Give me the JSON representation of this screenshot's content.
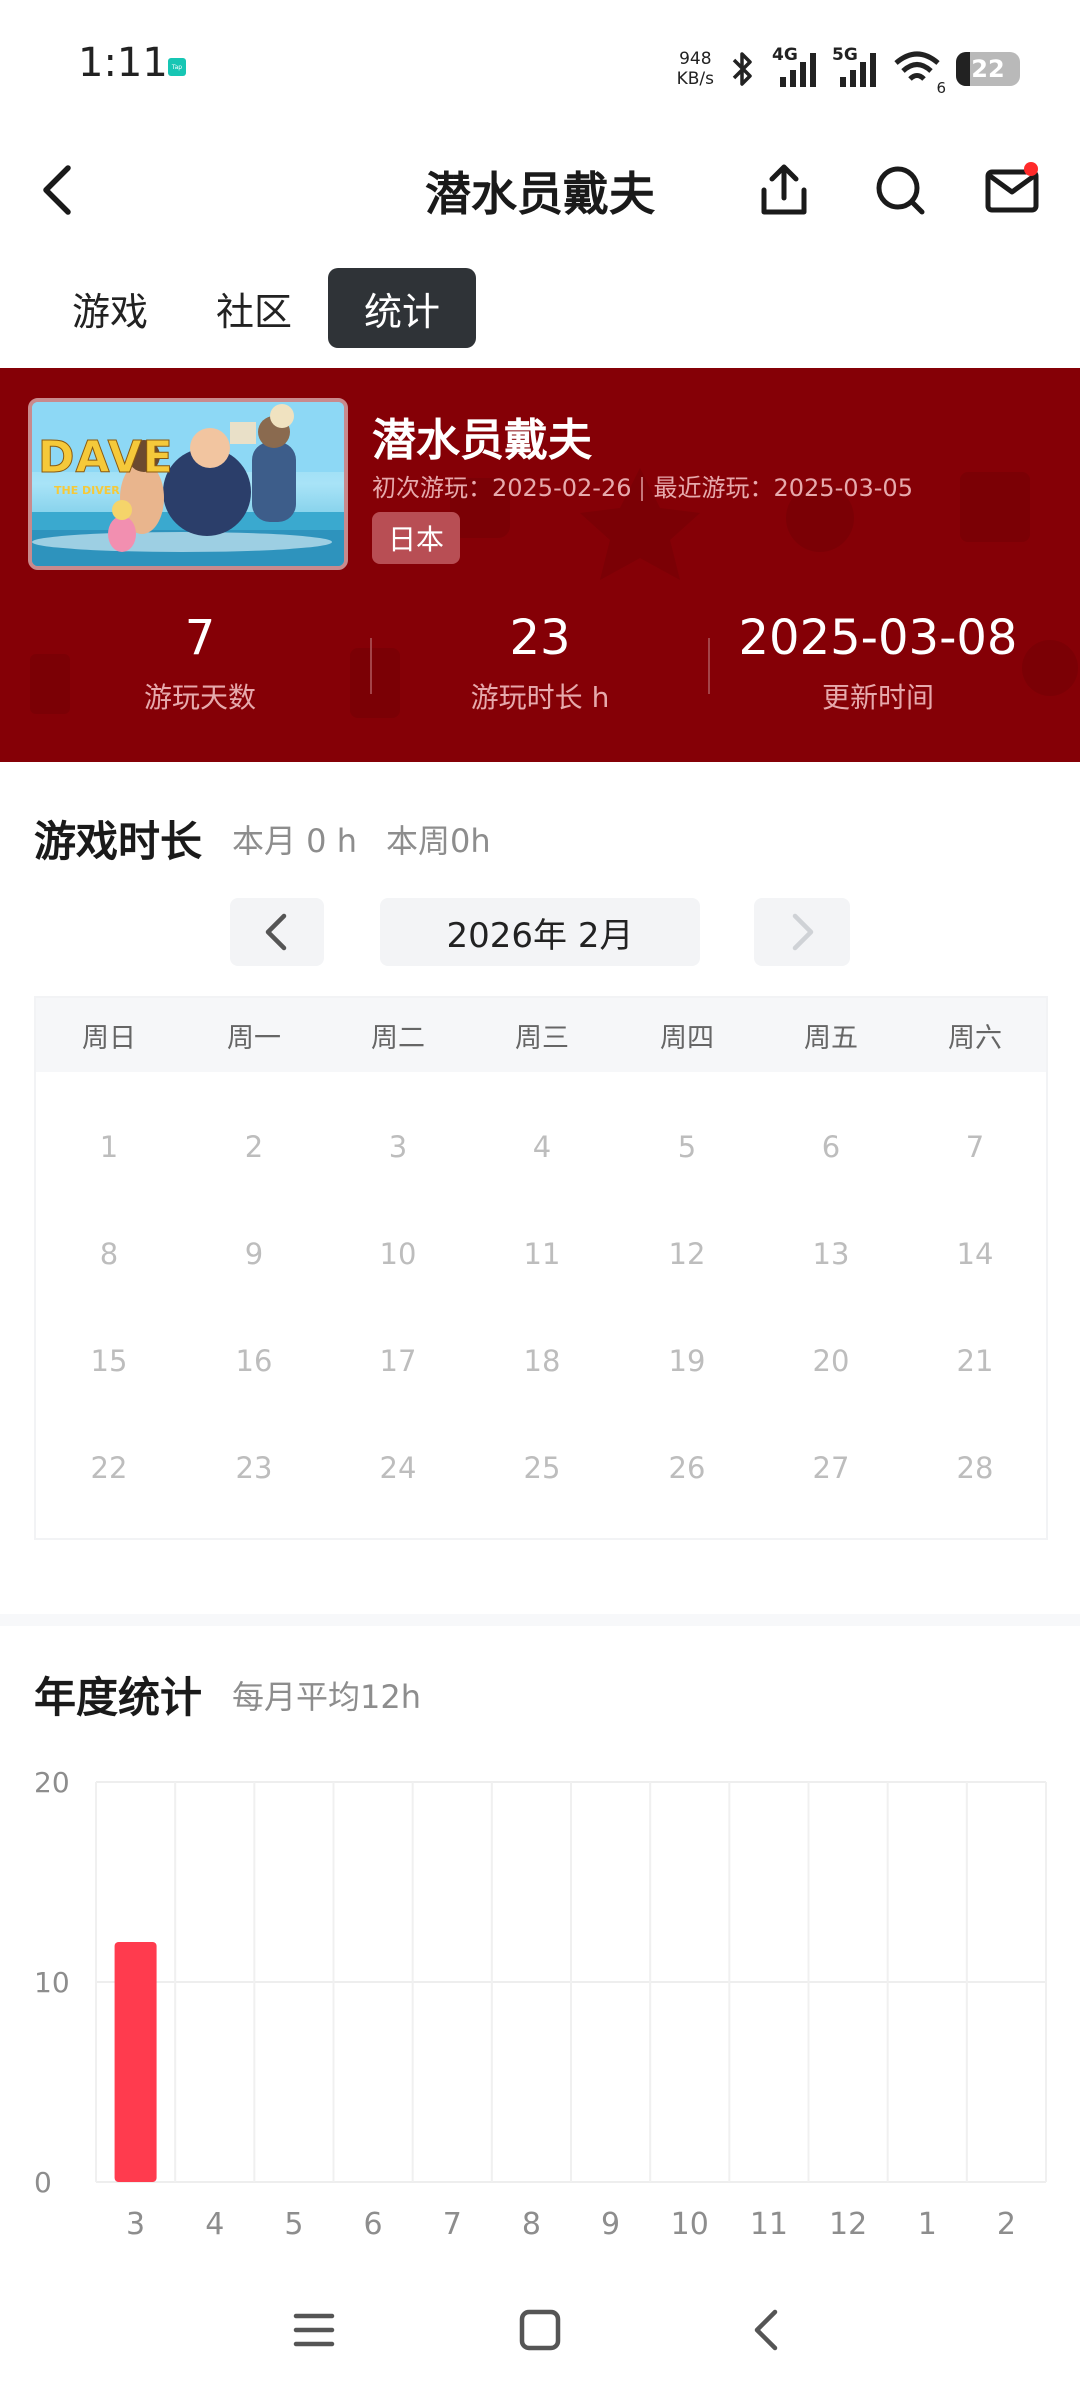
{
  "status_bar": {
    "time": "1:11",
    "net_speed_value": "948",
    "net_speed_unit": "KB/s",
    "signal_1_label": "4G",
    "signal_2_label": "5G",
    "wifi_label": "6",
    "battery": "22",
    "app_badge": "Tap"
  },
  "header": {
    "title": "潜水员戴夫"
  },
  "tabs": [
    {
      "label": "游戏",
      "active": false
    },
    {
      "label": "社区",
      "active": false
    },
    {
      "label": "统计",
      "active": true
    }
  ],
  "game": {
    "name": "潜水员戴夫",
    "cover_text": "DAVE",
    "cover_subtext": "THE DIVER",
    "first_played_label": "初次游玩：",
    "first_played": "2025-02-26",
    "last_played_label": "最近游玩：",
    "last_played": "2025-03-05",
    "region": "日本"
  },
  "stats": [
    {
      "value": "7",
      "label": "游玩天数"
    },
    {
      "value": "23",
      "label": "游玩时长 h"
    },
    {
      "value": "2025-03-08",
      "label": "更新时间"
    }
  ],
  "playtime": {
    "title": "游戏时长",
    "this_month": "本月  0  h",
    "this_week": "本周0h",
    "month_label": "2026年 2月",
    "weekdays": [
      "周日",
      "周一",
      "周二",
      "周三",
      "周四",
      "周五",
      "周六"
    ],
    "weeks": [
      [
        "1",
        "2",
        "3",
        "4",
        "5",
        "6",
        "7"
      ],
      [
        "8",
        "9",
        "10",
        "11",
        "12",
        "13",
        "14"
      ],
      [
        "15",
        "16",
        "17",
        "18",
        "19",
        "20",
        "21"
      ],
      [
        "22",
        "23",
        "24",
        "25",
        "26",
        "27",
        "28"
      ]
    ]
  },
  "annual": {
    "title": "年度统计",
    "subtitle": "每月平均12h"
  },
  "chart_data": {
    "type": "bar",
    "title": "",
    "xlabel": "",
    "ylabel": "",
    "categories": [
      "3",
      "4",
      "5",
      "6",
      "7",
      "8",
      "9",
      "10",
      "11",
      "12",
      "1",
      "2"
    ],
    "values": [
      12,
      0,
      0,
      0,
      0,
      0,
      0,
      0,
      0,
      0,
      0,
      0
    ],
    "ylim": [
      0,
      20
    ],
    "yticks": [
      0,
      10,
      20
    ],
    "grid": true,
    "bar_color": "#ff3b4e"
  },
  "colors": {
    "hero_bg": "#850006",
    "active_tab_bg": "#2f3337",
    "accent_red": "#ff3b4e"
  }
}
